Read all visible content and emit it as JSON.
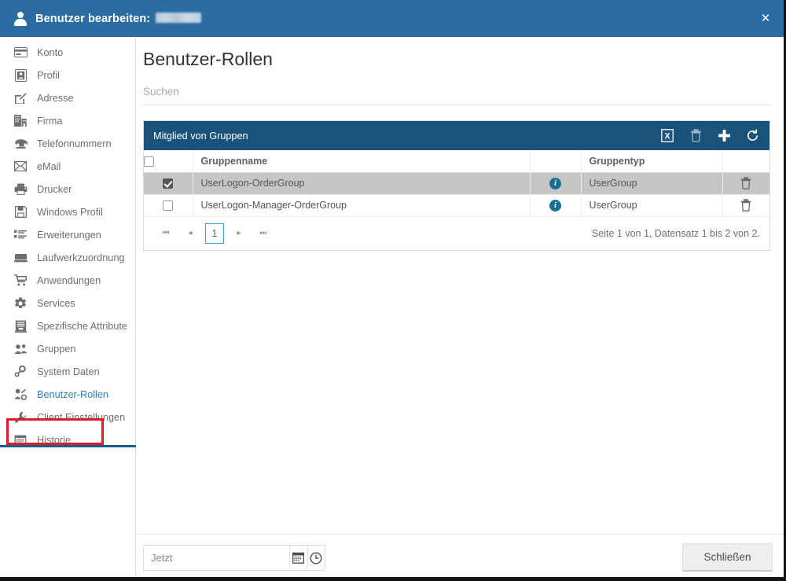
{
  "titlebar": {
    "icon": "user-icon",
    "title": "Benutzer bearbeiten:",
    "redacted_value": "",
    "close_label": "✕"
  },
  "sidebar": {
    "items": [
      {
        "label": "Konto",
        "icon": "card-icon",
        "active": false
      },
      {
        "label": "Profil",
        "icon": "id-badge-icon",
        "active": false
      },
      {
        "label": "Adresse",
        "icon": "edit-square-icon",
        "active": false
      },
      {
        "label": "Firma",
        "icon": "building-icon",
        "active": false
      },
      {
        "label": "Telefonnummern",
        "icon": "phone-icon",
        "active": false
      },
      {
        "label": "eMail",
        "icon": "envelope-icon",
        "active": false
      },
      {
        "label": "Drucker",
        "icon": "printer-icon",
        "active": false
      },
      {
        "label": "Windows Profil",
        "icon": "floppy-disk-icon",
        "active": false
      },
      {
        "label": "Erweiterungen",
        "icon": "list-icon",
        "active": false
      },
      {
        "label": "Laufwerkzuordnung",
        "icon": "drive-icon",
        "active": false
      },
      {
        "label": "Anwendungen",
        "icon": "cart-icon",
        "active": false
      },
      {
        "label": "Services",
        "icon": "gear-icon",
        "active": false
      },
      {
        "label": "Spezifische Attribute",
        "icon": "archive-icon",
        "active": false
      },
      {
        "label": "Gruppen",
        "icon": "users-icon",
        "active": false
      },
      {
        "label": "System Daten",
        "icon": "node-icon",
        "active": false
      },
      {
        "label": "Benutzer-Rollen",
        "icon": "user-key-icon",
        "active": true
      },
      {
        "label": "Client Einstellungen",
        "icon": "wrench-icon",
        "active": false
      },
      {
        "label": "Historie",
        "icon": "calendar-icon",
        "active": false
      }
    ]
  },
  "main": {
    "page_title": "Benutzer-Rollen",
    "search": {
      "placeholder": "Suchen",
      "value": ""
    },
    "panel": {
      "title": "Mitglied von Gruppen",
      "tools": [
        {
          "name": "export-excel-icon",
          "title": "Excel"
        },
        {
          "name": "delete-icon",
          "title": "Löschen"
        },
        {
          "name": "add-icon",
          "title": "Hinzufügen"
        },
        {
          "name": "refresh-icon",
          "title": "Aktualisieren"
        }
      ],
      "columns": [
        "",
        "Gruppenname",
        "",
        "Gruppentyp",
        ""
      ],
      "rows": [
        {
          "checked": true,
          "selected": true,
          "gruppenname": "UserLogon-OrderGroup",
          "info": "i",
          "gruppentyp": "UserGroup",
          "delete": "trash-icon"
        },
        {
          "checked": false,
          "selected": false,
          "gruppenname": "UserLogon-Manager-OrderGroup",
          "info": "i",
          "gruppentyp": "UserGroup",
          "delete": "trash-icon"
        }
      ],
      "pager": {
        "first": "⏮",
        "prev": "◂",
        "current_page": "1",
        "next": "▸",
        "last": "⏭",
        "status": "Seite 1 von 1, Datensatz 1 bis 2 von 2."
      }
    }
  },
  "bottombar": {
    "date": {
      "placeholder": "Jetzt",
      "value": ""
    },
    "calendar_icon": "calendar-icon",
    "clock_icon": "clock-icon",
    "close_button": "Schließen"
  },
  "colors": {
    "titlebar": "#2b6ca3",
    "panel_header": "#19527a",
    "accent_link": "#2e7ebb",
    "annotation": "#e01b24",
    "info_badge": "#1a6e96",
    "row_selected": "#c6c6c6"
  }
}
